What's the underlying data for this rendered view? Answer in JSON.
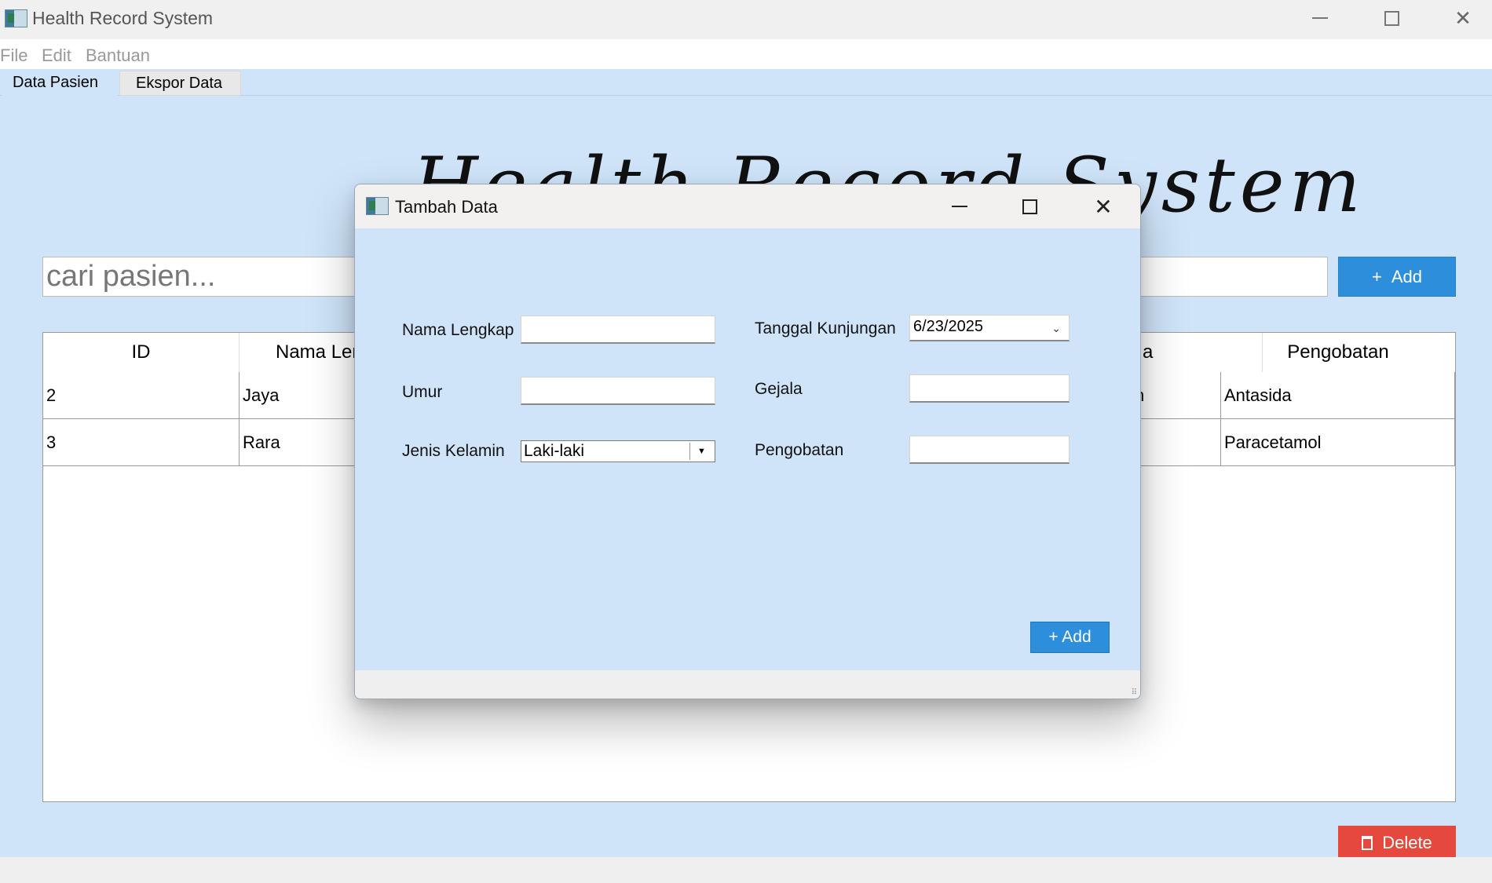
{
  "window": {
    "title": "Health Record System",
    "min_glyph": "",
    "max_glyph": "",
    "close_glyph": "✕"
  },
  "menu": [
    "File",
    "Edit",
    "Bantuan"
  ],
  "tabs": [
    {
      "label": "Data Pasien",
      "active": true
    },
    {
      "label": "Ekspor Data",
      "active": false
    }
  ],
  "main": {
    "heading": "Health Record System",
    "search_placeholder": "cari pasien...",
    "add_button": "Add",
    "add_icon": "+",
    "delete_button": "Delete",
    "table": {
      "visible_headers": [
        "ID",
        "Nama Ler",
        "a",
        "Pengobatan"
      ],
      "rows": [
        {
          "id": "2",
          "nama": "Jaya",
          "partial": "n",
          "pengobatan": "Antasida"
        },
        {
          "id": "3",
          "nama": "Rara",
          "partial": "",
          "pengobatan": "Paracetamol"
        }
      ]
    }
  },
  "dialog": {
    "title": "Tambah Data",
    "close_glyph": "✕",
    "labels": {
      "nama": "Nama Lengkap",
      "umur": "Umur",
      "jenis_kelamin": "Jenis Kelamin",
      "tanggal": "Tanggal Kunjungan",
      "gejala": "Gejala",
      "pengobatan": "Pengobatan"
    },
    "values": {
      "nama": "",
      "umur": "",
      "jenis_kelamin": "Laki-laki",
      "tanggal": "6/23/2025",
      "gejala": "",
      "pengobatan": ""
    },
    "add_button": "+ Add"
  },
  "colors": {
    "accent": "#2d8fdb",
    "danger": "#e5483c",
    "background": "#cfe4f9"
  }
}
